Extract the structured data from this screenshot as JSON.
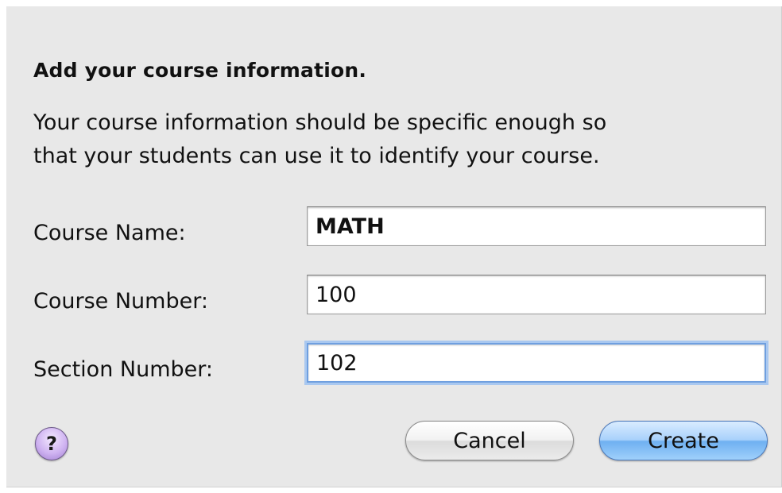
{
  "dialog": {
    "heading": "Add your course information.",
    "description_line1": "Your course information should be specific enough so",
    "description_line2": "that your students can use it to identify your course.",
    "fields": [
      {
        "label": "Course Name:",
        "value": "MATH"
      },
      {
        "label": "Course Number:",
        "value": "100"
      },
      {
        "label": "Section Number:",
        "value": "102"
      }
    ],
    "help_label": "?",
    "cancel_label": "Cancel",
    "create_label": "Create"
  },
  "colors": {
    "background": "#e8e8e8",
    "focus_ring": "#6f9fdf",
    "default_button": "#6fb0f1",
    "help_button": "#cfb3f1"
  },
  "icons": {
    "help": "question-mark-icon"
  }
}
